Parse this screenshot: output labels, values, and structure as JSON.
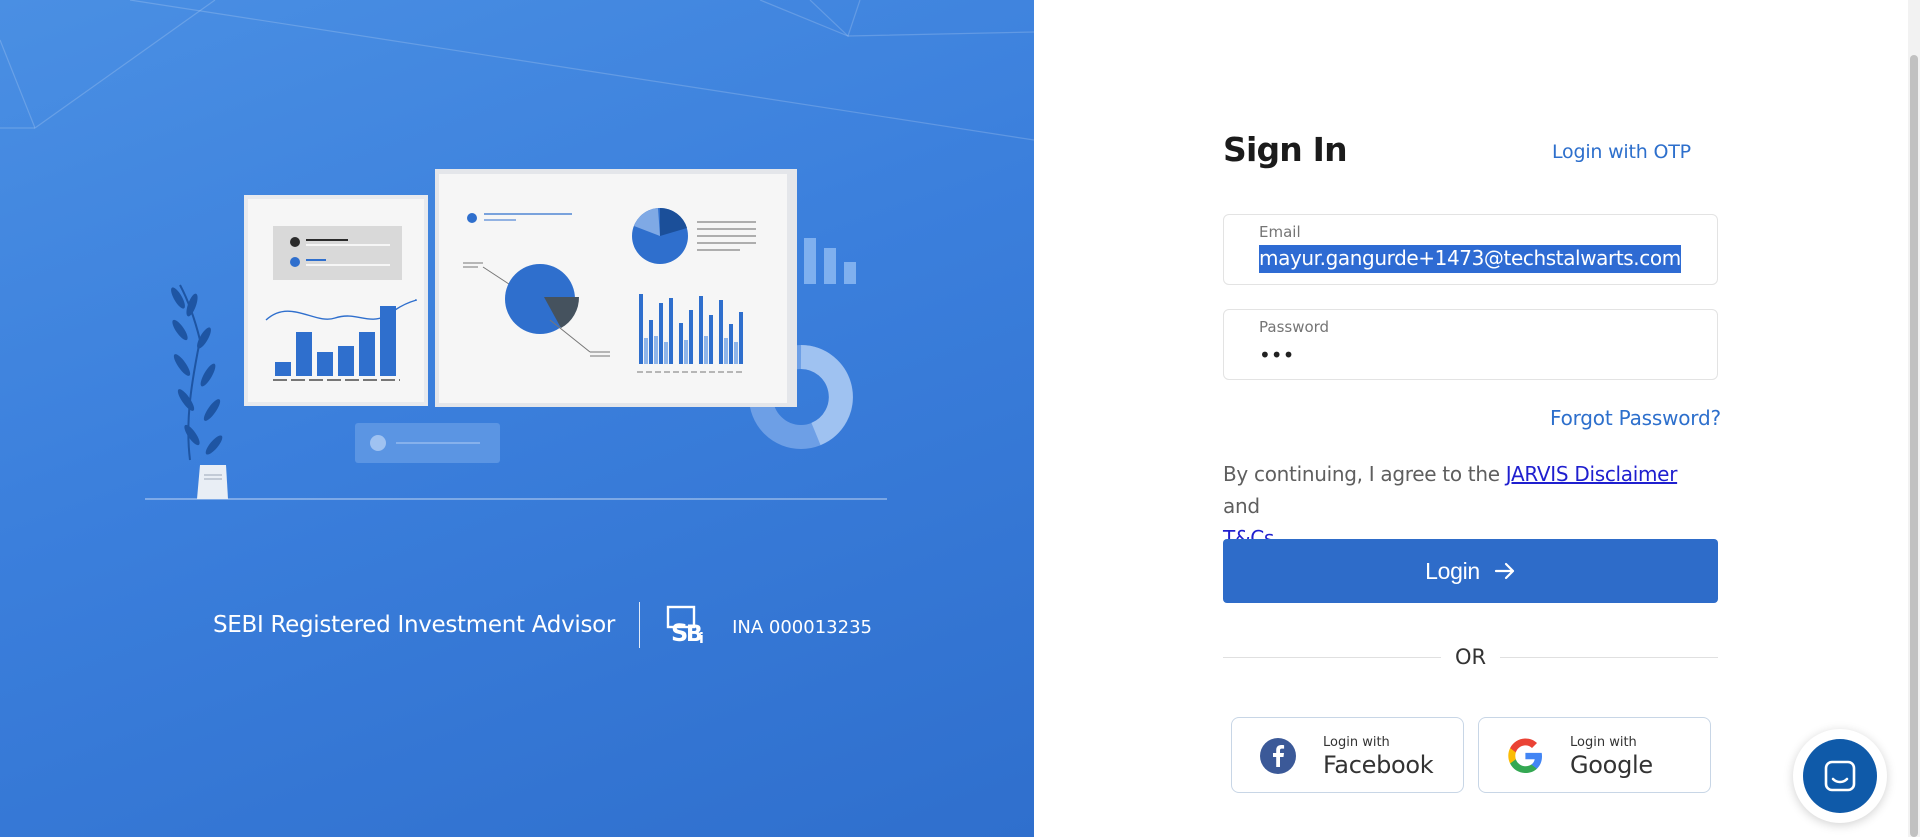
{
  "branding": {
    "sebi_text": "SEBI Registered Investment Advisor",
    "ina_text": "INA 000013235",
    "logo_icon": "sebi-logo-icon"
  },
  "signin": {
    "title": "Sign In",
    "otp_link": "Login with OTP",
    "email_label": "Email",
    "email_value": "mayur.gangurde+1473@techstalwarts.com",
    "password_label": "Password",
    "password_value": "•••",
    "forgot_link": "Forgot Password?",
    "agree_prefix": "By continuing, I agree to the ",
    "disclaimer_link": "JARVIS Disclaimer",
    "agree_mid": " and",
    "tcs_link": "T&Cs",
    "agree_suffix": ".",
    "login_button": "Login",
    "or_text": "OR"
  },
  "social": {
    "facebook_small": "Login with",
    "facebook_big": "Facebook",
    "google_small": "Login with",
    "google_big": "Google"
  },
  "colors": {
    "panel_blue": "#3b7fdc",
    "accent": "#2e6cc9",
    "link": "#2d6fcc",
    "selection": "#2e6bd3",
    "chat_widget": "#0f5aa9"
  }
}
